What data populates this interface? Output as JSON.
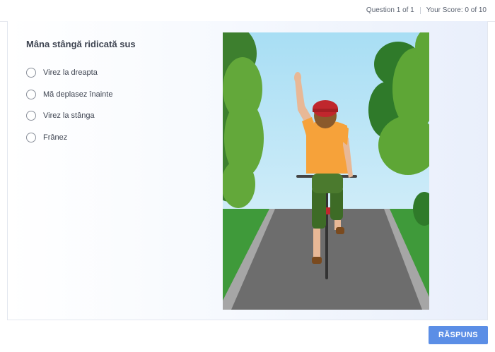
{
  "header": {
    "question_counter": "Question 1 of 1",
    "score": "Your Score: 0 of 10"
  },
  "question": {
    "text": "Mâna stângă ridicată sus",
    "options": [
      {
        "label": "Virez la dreapta"
      },
      {
        "label": "Mă deplasez înainte"
      },
      {
        "label": "Virez la stânga"
      },
      {
        "label": "Frânez"
      }
    ]
  },
  "illustration": {
    "subject": "cyclist-left-arm-raised"
  },
  "footer": {
    "answer_label": "RĂSPUNS"
  },
  "colors": {
    "accent": "#5b8ee6",
    "sky": "#bfe6f7",
    "road": "#6f6f6f",
    "shirt": "#f6a23a",
    "helmet": "#c0272d"
  }
}
